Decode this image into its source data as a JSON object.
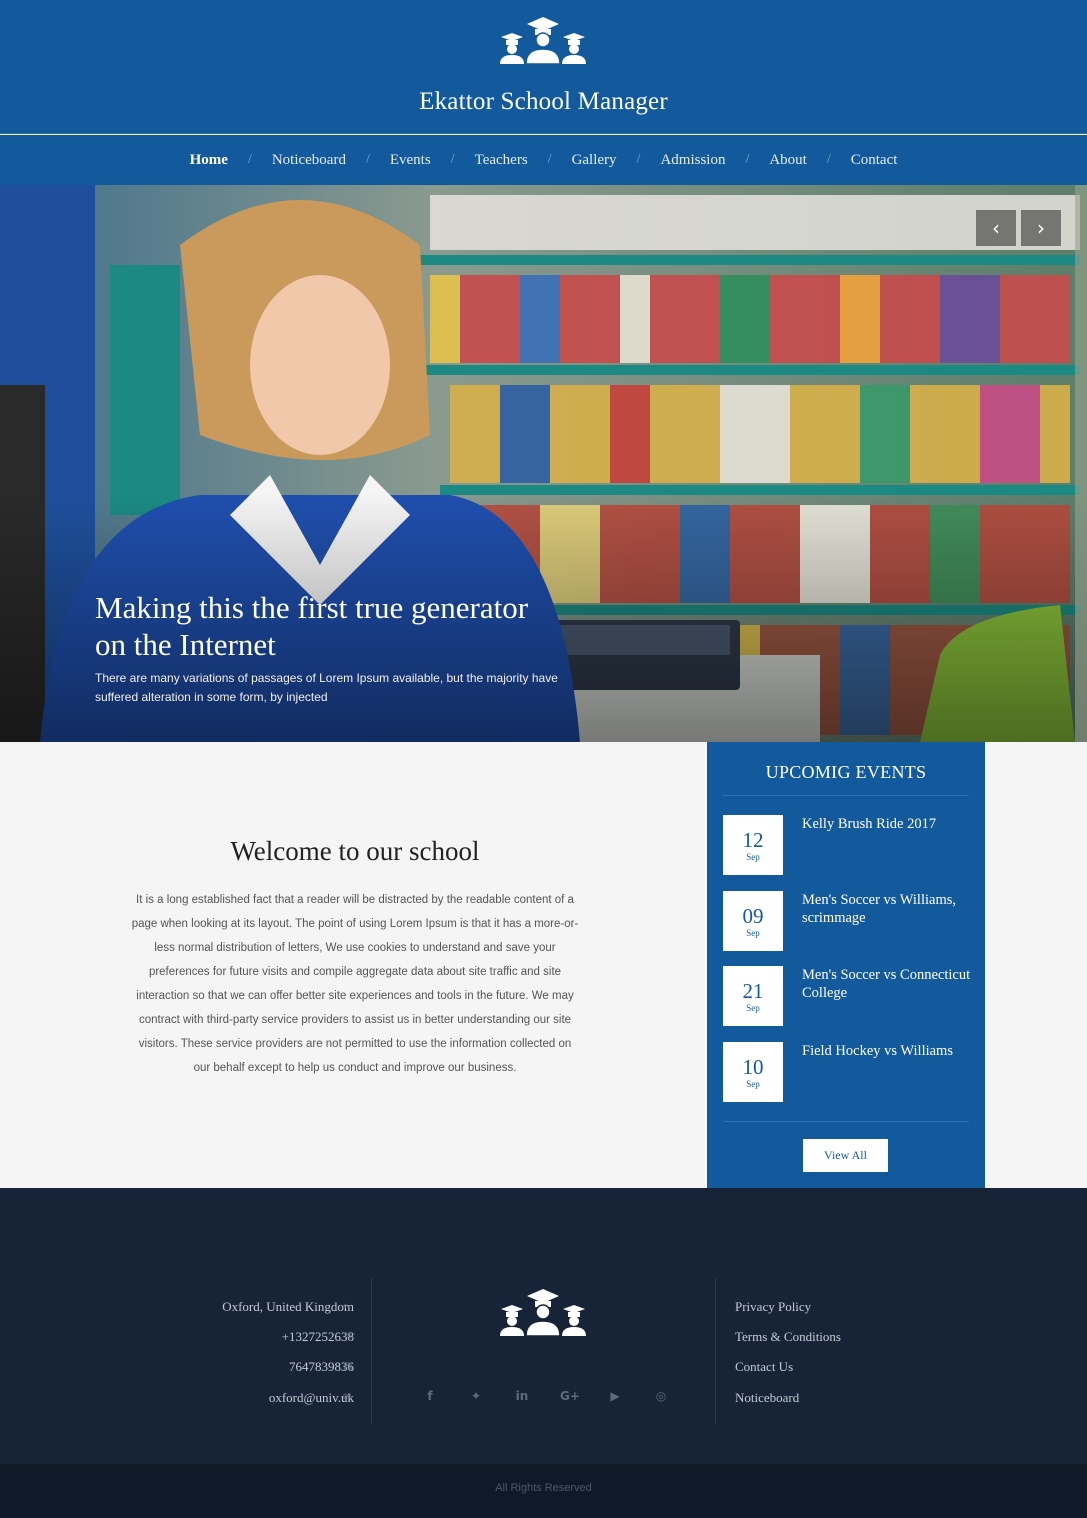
{
  "site": {
    "title": "Ekattor School Manager",
    "logo_icon": "graduates-icon"
  },
  "nav": {
    "items": [
      {
        "label": "Home",
        "active": true
      },
      {
        "label": "Noticeboard"
      },
      {
        "label": "Events"
      },
      {
        "label": "Teachers"
      },
      {
        "label": "Gallery"
      },
      {
        "label": "Admission"
      },
      {
        "label": "About"
      },
      {
        "label": "Contact"
      }
    ],
    "separator": "/"
  },
  "hero": {
    "title_line1": "Making this the first true generator",
    "title_line2": "on the Internet",
    "subtitle_line1": "There are many variations of passages of Lorem Ipsum available, but the majority have",
    "subtitle_line2": "suffered alteration in some form, by injected",
    "prev_glyph": "‹",
    "next_glyph": "›"
  },
  "welcome": {
    "title": "Welcome to our school",
    "lines": [
      "It is a long established fact that a reader will be distracted by the readable content of a",
      "page when looking at its layout. The point of using Lorem Ipsum is that it has a more-or-",
      "less normal distribution of letters, We use cookies to understand and save your",
      "preferences for future visits and compile aggregate data about site traffic and site",
      "interaction so that we can offer better site experiences and tools in the future. We may",
      "contract with third-party service providers to assist us in better understanding our site",
      "visitors. These service providers are not permitted to use the information collected on",
      "our behalf except to help us conduct and improve our business."
    ]
  },
  "events": {
    "title": "UPCOMIG EVENTS",
    "items": [
      {
        "day": "12",
        "month": "Sep",
        "name": "Kelly Brush Ride 2017"
      },
      {
        "day": "09",
        "month": "Sep",
        "name": "Men's Soccer vs Williams, scrimmage"
      },
      {
        "day": "21",
        "month": "Sep",
        "name": "Men's Soccer vs Connecticut College"
      },
      {
        "day": "10",
        "month": "Sep",
        "name": "Field Hockey vs Williams"
      }
    ],
    "view_all": "View All"
  },
  "footer": {
    "contacts": [
      {
        "text": "Oxford, United Kingdom",
        "icon": "map-pin-icon"
      },
      {
        "text": "+1327252638",
        "icon": "phone-icon"
      },
      {
        "text": "7647839836",
        "icon": "fax-icon"
      },
      {
        "text": "oxford@univ.uk",
        "icon": "envelope-icon"
      }
    ],
    "social": [
      {
        "icon": "facebook-icon"
      },
      {
        "icon": "twitter-icon"
      },
      {
        "icon": "linkedin-icon"
      },
      {
        "icon": "google-plus-icon"
      },
      {
        "icon": "youtube-icon"
      },
      {
        "icon": "instagram-icon"
      }
    ],
    "links": [
      "Privacy Policy",
      "Terms & Conditions",
      "Contact Us",
      "Noticeboard"
    ],
    "copyright": "All Rights Reserved"
  },
  "colors": {
    "primary": "#135a9c",
    "footer": "#172437",
    "bottom_bar": "#0f1a28"
  }
}
